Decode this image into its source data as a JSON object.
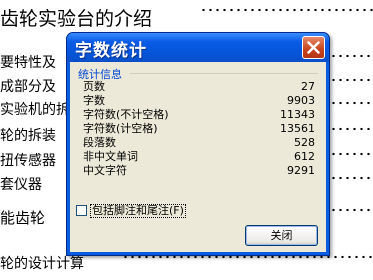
{
  "background_doc": {
    "lines": [
      {
        "text": "齿轮实验台的介绍",
        "level": "h1"
      },
      {
        "text": "要特性及",
        "level": "h3"
      },
      {
        "text": "成部分及",
        "level": "h3"
      },
      {
        "text": "实验机的拆",
        "level": "h3"
      },
      {
        "text": "轮的拆装",
        "level": "h3"
      },
      {
        "text": "扭传感器",
        "level": "h3"
      },
      {
        "text": "套仪器",
        "level": "h3"
      },
      {
        "text": "能齿轮",
        "level": "h2"
      },
      {
        "text": "轮的设计计算",
        "level": "h3"
      }
    ]
  },
  "dialog": {
    "title": "字数统计",
    "close_icon": "close-x-icon",
    "group_label": "统计信息",
    "stats": [
      {
        "label": "页数",
        "value": "27"
      },
      {
        "label": "字数",
        "value": "9903"
      },
      {
        "label": "字符数(不计空格)",
        "value": "11343"
      },
      {
        "label": "字符数(计空格)",
        "value": "13561"
      },
      {
        "label": "段落数",
        "value": "528"
      },
      {
        "label": "非中文单词",
        "value": "612"
      },
      {
        "label": "中文字符",
        "value": "9291"
      }
    ],
    "checkbox_label": "包括脚注和尾注(F)",
    "checkbox_checked": false,
    "close_button_label": "关闭"
  },
  "colors": {
    "title_bar": "#0a5ce6",
    "close_button": "#c6431c",
    "client_bg": "#ece9d8",
    "group_label": "#0046d5"
  }
}
